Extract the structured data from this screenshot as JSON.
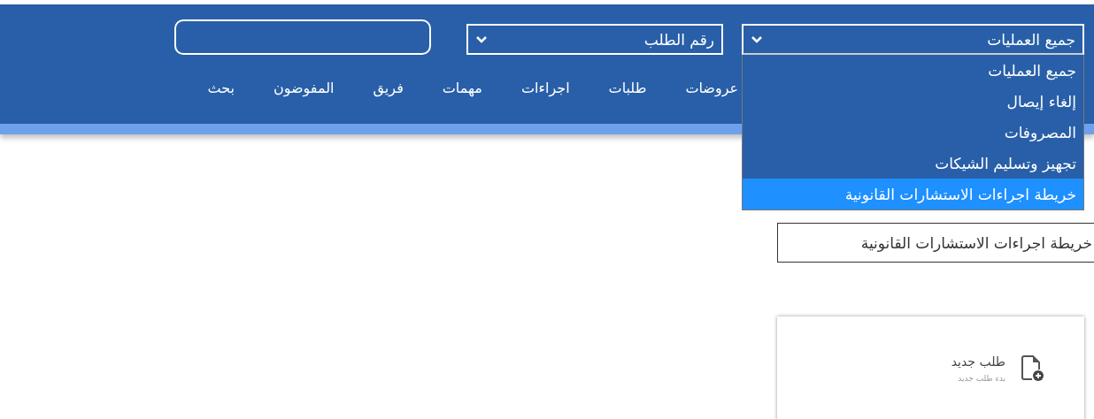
{
  "filters": [
    {
      "value": "جميع العمليات",
      "expanded": true,
      "options": [
        {
          "label": "جميع العمليات",
          "highlighted": false
        },
        {
          "label": "إلغاء إيصال",
          "highlighted": false
        },
        {
          "label": "المصروفات",
          "highlighted": false
        },
        {
          "label": "تجهيز وتسليم الشيكات",
          "highlighted": false
        },
        {
          "label": "خريطة اجراءات الاستشارات القانونية",
          "highlighted": true
        }
      ]
    },
    {
      "value": "رقم الطلب",
      "expanded": false
    }
  ],
  "nav": [
    {
      "label": "عروضات"
    },
    {
      "label": "طلبات"
    },
    {
      "label": "اجراءات"
    },
    {
      "label": "مهمات"
    },
    {
      "label": "فريق"
    },
    {
      "label": "المفوضون"
    },
    {
      "label": "بحث"
    }
  ],
  "selected_process": "خريطة اجراءات الاستشارات القانونية",
  "action_card": {
    "title": "طلب جديد",
    "subtitle": "بدء طلب جديد"
  }
}
